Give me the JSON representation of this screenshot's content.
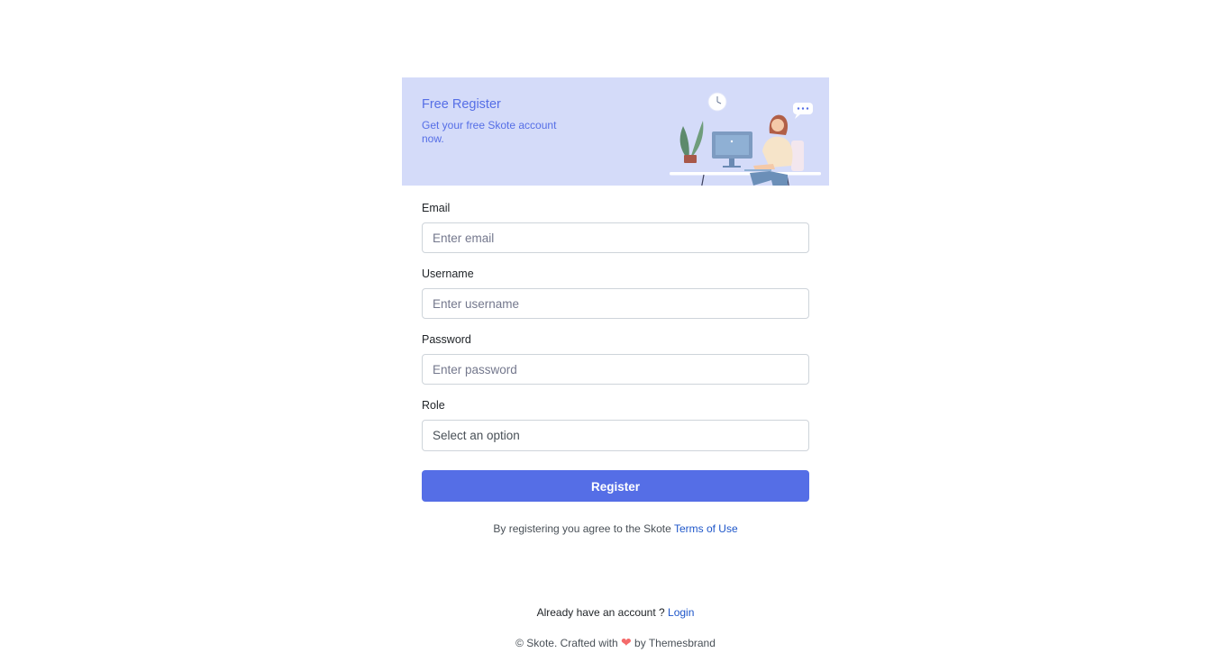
{
  "banner": {
    "title": "Free Register",
    "subtitle": "Get your free Skote account now."
  },
  "form": {
    "email": {
      "label": "Email",
      "placeholder": "Enter email"
    },
    "username": {
      "label": "Username",
      "placeholder": "Enter username"
    },
    "password": {
      "label": "Password",
      "placeholder": "Enter password"
    },
    "role": {
      "label": "Role",
      "selected": "Select an option"
    },
    "submit_label": "Register"
  },
  "terms": {
    "prefix": "By registering you agree to the Skote ",
    "link": "Terms of Use"
  },
  "footer": {
    "login_prompt": "Already have an account ? ",
    "login_link": "Login",
    "copyright_prefix": "© Skote. Crafted with ",
    "copyright_suffix": " by Themesbrand"
  },
  "colors": {
    "accent": "#556ee6",
    "banner_bg": "#d4dbf9",
    "link": "#1e56c9",
    "heart": "#f46a6a"
  },
  "icons": {
    "heart": "heart-icon",
    "illustration": "profile-illustration"
  }
}
